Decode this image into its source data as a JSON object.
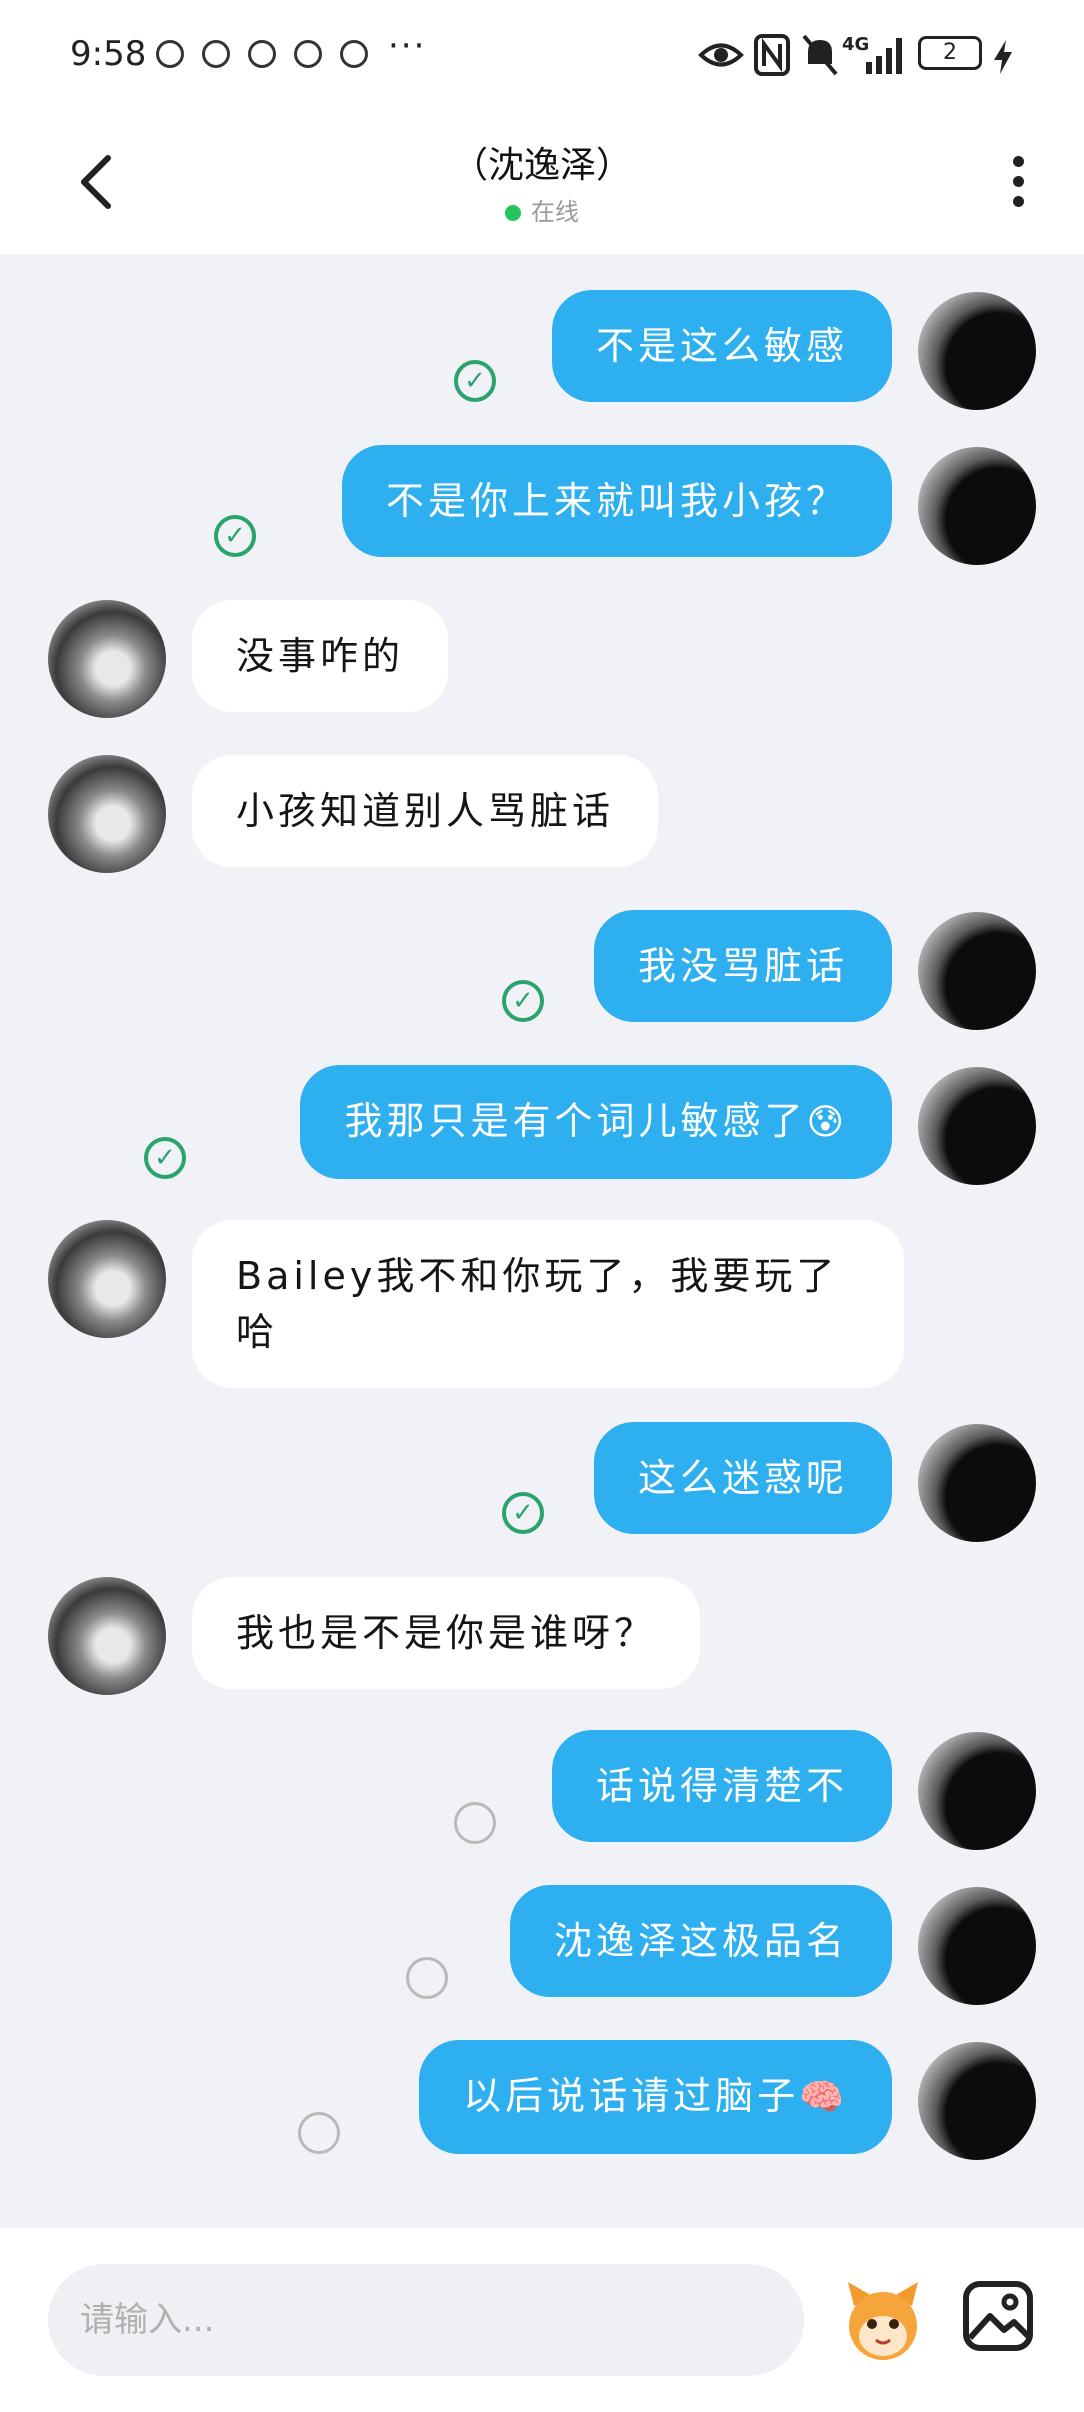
{
  "status_bar": {
    "time": "9:58",
    "more": "···",
    "network": "4G",
    "battery": "2"
  },
  "header": {
    "title": "（沈逸泽）",
    "status": "在线"
  },
  "messages": [
    {
      "from": "me",
      "text": "不是这么敏感",
      "state": "read"
    },
    {
      "from": "me",
      "text": "不是你上来就叫我小孩？",
      "state": "read"
    },
    {
      "from": "them",
      "text": "没事咋的"
    },
    {
      "from": "them",
      "text": "小孩知道别人骂脏话"
    },
    {
      "from": "me",
      "text": "我没骂脏话",
      "state": "read"
    },
    {
      "from": "me",
      "text": "我那只是有个词儿敏感了",
      "emoji": "😰",
      "state": "read"
    },
    {
      "from": "them",
      "text": "Bailey我不和你玩了，我要玩了哈"
    },
    {
      "from": "me",
      "text": "这么迷惑呢",
      "state": "read"
    },
    {
      "from": "them",
      "text": "我也是不是你是谁呀？"
    },
    {
      "from": "me",
      "text": "话说得清楚不",
      "state": "sent"
    },
    {
      "from": "me",
      "text": "沈逸泽这极品名",
      "state": "sent"
    },
    {
      "from": "me",
      "text": "以后说话请过脑子",
      "emoji": "🧠",
      "state": "sent"
    }
  ],
  "input": {
    "placeholder": "请输入..."
  },
  "colors": {
    "bubble_me": "#2eb0f0",
    "bubble_them": "#ffffff",
    "read_check": "#2ba36c",
    "online": "#22c55e"
  }
}
